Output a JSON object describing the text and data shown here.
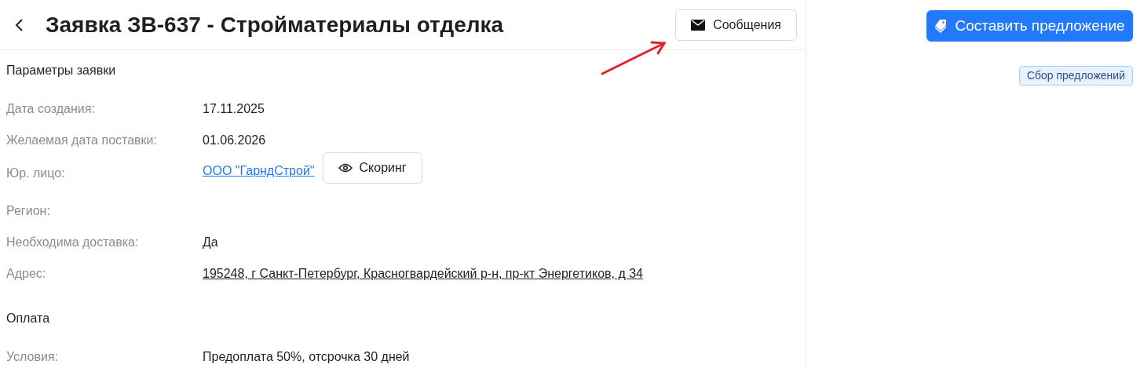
{
  "header": {
    "title": "Заявка ЗВ-637 - Стройматериалы отделка",
    "messages_button": "Сообщения"
  },
  "sections": [
    {
      "title": "Параметры заявки",
      "rows": [
        {
          "kind": "text",
          "label": "Дата создания:",
          "value": "17.11.2025"
        },
        {
          "kind": "text",
          "label": "Желаемая дата поставки:",
          "value": "01.06.2026"
        },
        {
          "kind": "link",
          "label": "Юр. лицо:",
          "value": "ООО \"ГарндСтрой\"",
          "button": "Скоринг"
        },
        {
          "kind": "text",
          "label": "Регион:"
        },
        {
          "kind": "text",
          "label": "Необходима доставка:",
          "value": "Да"
        },
        {
          "kind": "address",
          "label": "Адрес:",
          "value": "195248, г Санкт-Петербург, Красногвардейский р-н, пр-кт Энергетиков, д 34"
        }
      ]
    },
    {
      "title": "Оплата",
      "rows": [
        {
          "kind": "text",
          "label": "Условия:",
          "value": "Предоплата 50%, отсрочка 30 дней"
        }
      ]
    }
  ],
  "sidebar": {
    "offer_button": "Составить предложение",
    "status_tag": "Сбор предложений"
  }
}
